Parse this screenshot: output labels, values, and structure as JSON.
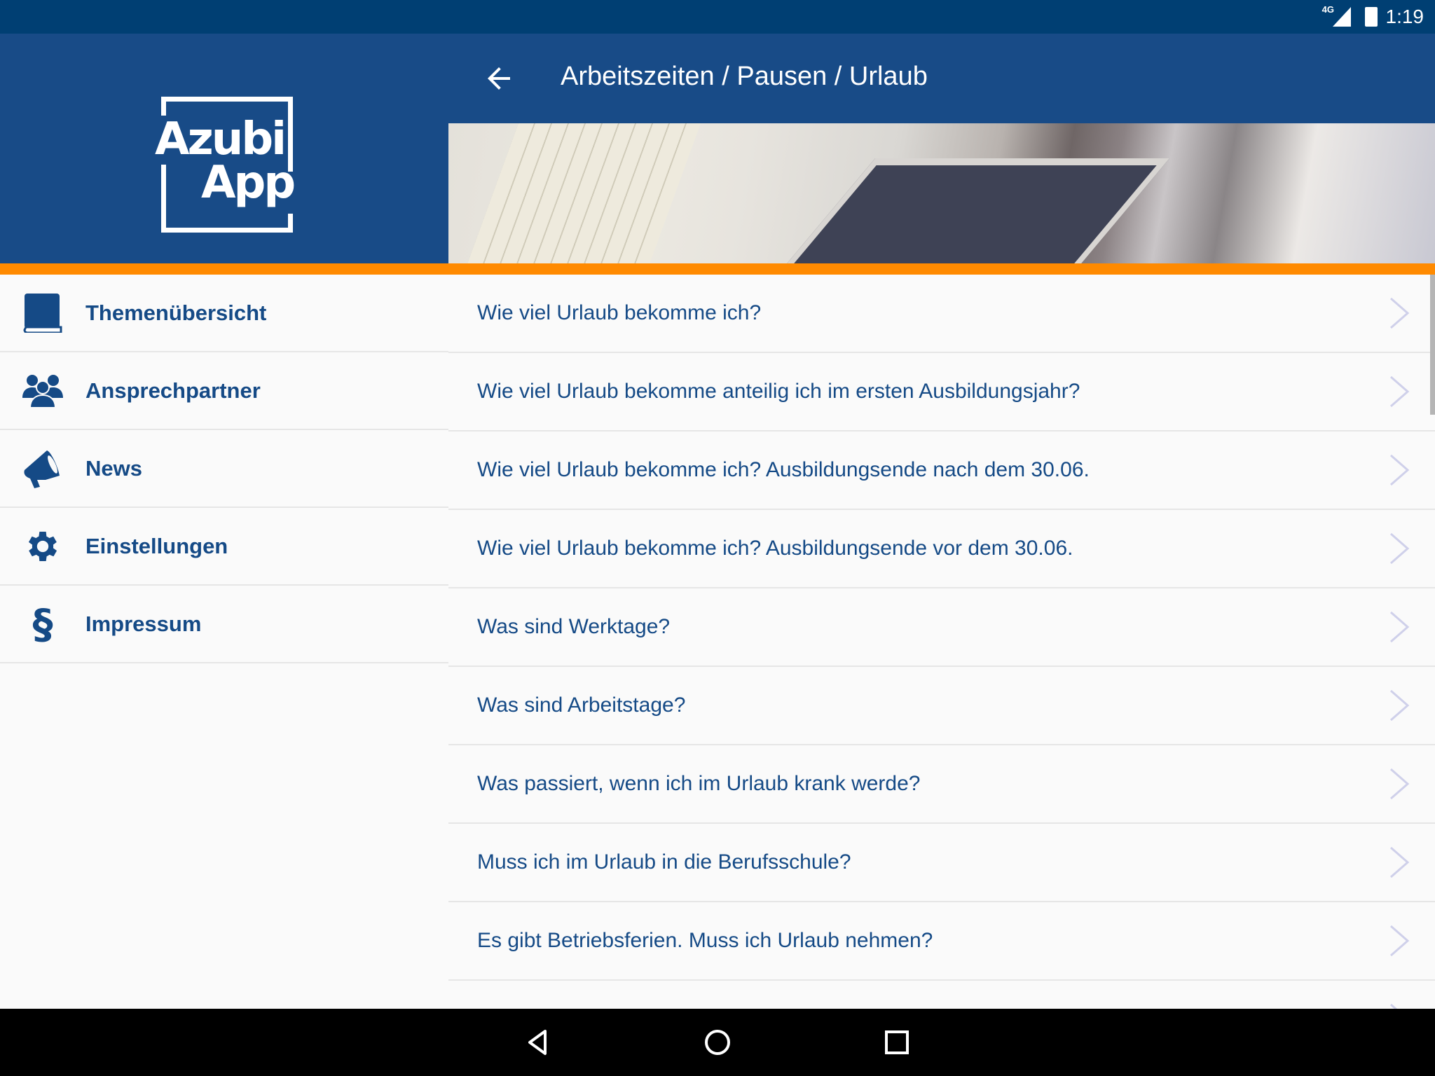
{
  "status_bar": {
    "network": "4G",
    "time": "1:19"
  },
  "logo": {
    "line1": "Azubi",
    "line2": "App"
  },
  "app_bar": {
    "title": "Arbeitszeiten / Pausen / Urlaub",
    "back_icon": "arrow-left-icon"
  },
  "colors": {
    "primary": "#184b87",
    "status": "#003f73",
    "accent": "#ff8a00",
    "text": "#154a86"
  },
  "sidebar": {
    "items": [
      {
        "label": "Themenübersicht",
        "icon": "book-icon"
      },
      {
        "label": "Ansprechpartner",
        "icon": "users-icon"
      },
      {
        "label": "News",
        "icon": "megaphone-icon"
      },
      {
        "label": "Einstellungen",
        "icon": "gear-icon"
      },
      {
        "label": "Impressum",
        "icon": "paragraph-icon"
      }
    ]
  },
  "list": {
    "items": [
      "Wie viel Urlaub bekomme ich?",
      "Wie viel Urlaub bekomme anteilig ich im ersten Ausbildungsjahr?",
      "Wie viel Urlaub bekomme ich? Ausbildungsende nach dem 30.06.",
      "Wie viel Urlaub bekomme ich? Ausbildungsende vor dem 30.06.",
      "Was sind Werktage?",
      "Was sind Arbeitstage?",
      "Was passiert, wenn ich im Urlaub krank werde?",
      "Muss ich im Urlaub in die Berufsschule?",
      "Es gibt Betriebsferien. Muss ich Urlaub nehmen?",
      ""
    ]
  }
}
